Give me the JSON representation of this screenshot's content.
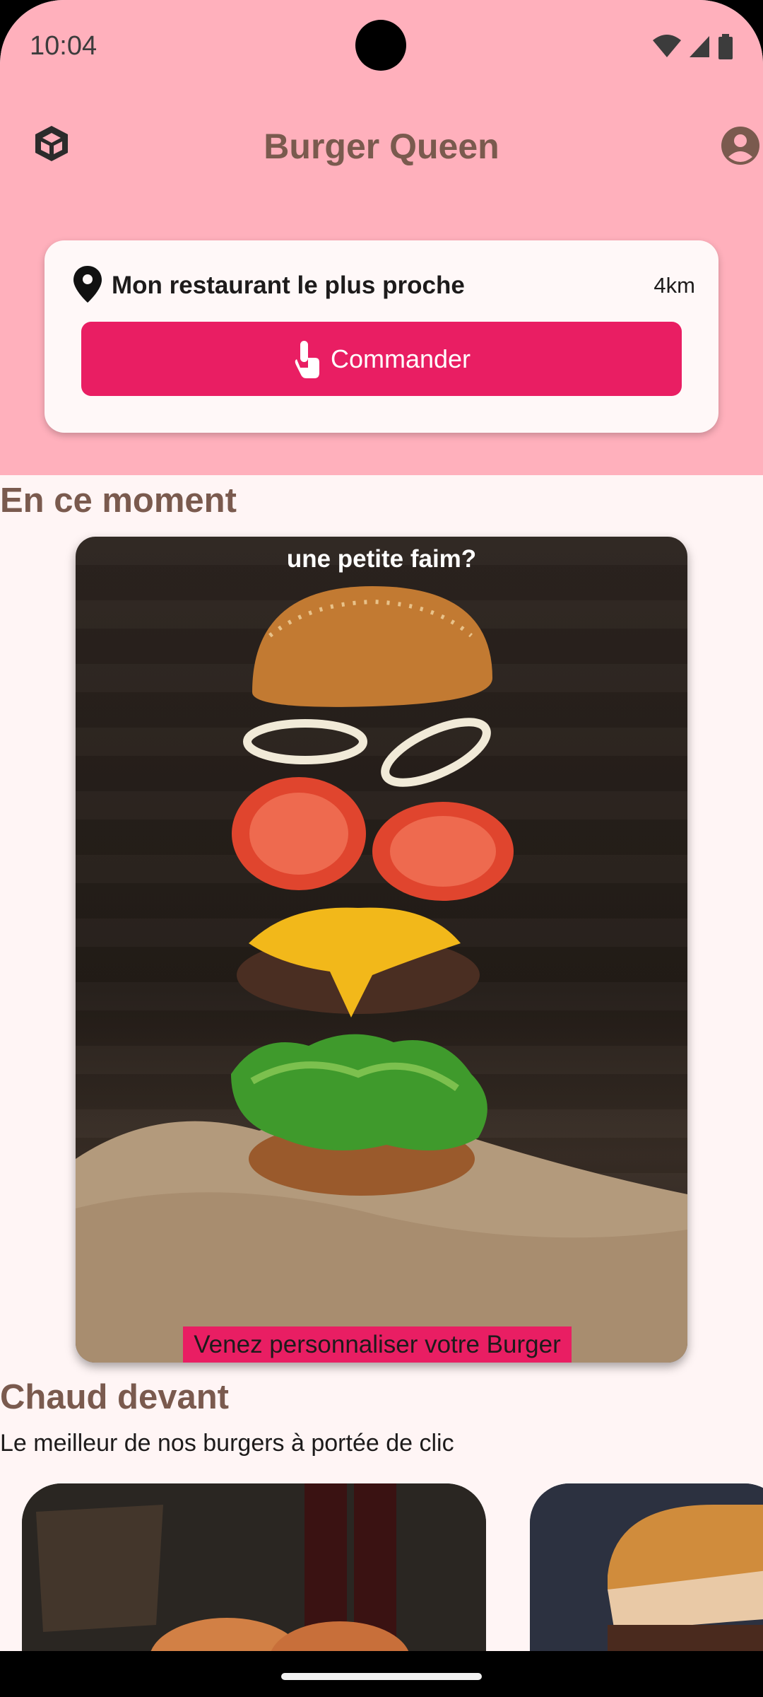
{
  "status_bar": {
    "time": "10:04"
  },
  "app_bar": {
    "title": "Burger Queen",
    "left_icon": "cube-icon",
    "right_icon": "account-circle-icon"
  },
  "restaurant_card": {
    "label": "Mon restaurant le plus proche",
    "distance": "4km",
    "button_label": "Commander",
    "button_icon": "touch-hand-icon"
  },
  "section_now": {
    "title": "En ce moment"
  },
  "promo": {
    "caption_top": "une petite faim?",
    "caption_bottom": "Venez personnaliser votre Burger"
  },
  "section_hot": {
    "title": "Chaud devant",
    "subtitle": "Le meilleur de nos burgers à portée de clic"
  },
  "colors": {
    "header_bg": "#FFB0BC",
    "accent": "#E91E63",
    "title_brown": "#7A5A4E",
    "page_bg": "#FFF5F5"
  }
}
